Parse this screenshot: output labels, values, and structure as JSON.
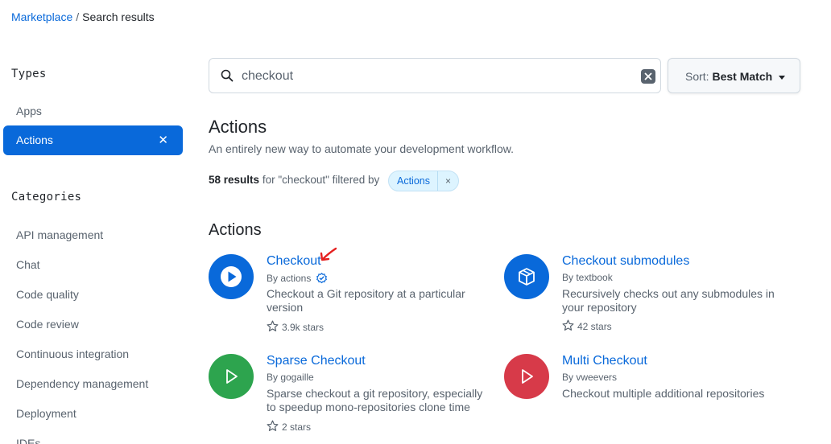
{
  "breadcrumb": {
    "root": "Marketplace",
    "separator": "/",
    "current": "Search results"
  },
  "sidebar": {
    "types_heading": "Types",
    "types": [
      {
        "label": "Apps"
      },
      {
        "label": "Actions",
        "remove": "✕"
      }
    ],
    "categories_heading": "Categories",
    "categories": [
      {
        "label": "API management"
      },
      {
        "label": "Chat"
      },
      {
        "label": "Code quality"
      },
      {
        "label": "Code review"
      },
      {
        "label": "Continuous integration"
      },
      {
        "label": "Dependency management"
      },
      {
        "label": "Deployment"
      },
      {
        "label": "IDEs"
      }
    ]
  },
  "search": {
    "value": "checkout",
    "clear_icon": "x-icon"
  },
  "sort": {
    "prefix": "Sort:",
    "value": "Best Match"
  },
  "header": {
    "title": "Actions",
    "subtitle": "An entirely new way to automate your development workflow."
  },
  "results": {
    "count": "58 results",
    "text": "for \"checkout\" filtered by",
    "chip": "Actions",
    "chip_remove": "×"
  },
  "list_title": "Actions",
  "cards": [
    {
      "name": "Checkout",
      "by": "By actions",
      "verified": true,
      "desc": "Checkout a Git repository at a particular version",
      "stars": "3.9k stars",
      "color": "#0969da",
      "icon": "play-icon"
    },
    {
      "name": "Checkout submodules",
      "by": "By textbook",
      "verified": false,
      "desc": "Recursively checks out any submodules in your repository",
      "stars": "42 stars",
      "color": "#0969da",
      "icon": "package-icon"
    },
    {
      "name": "Sparse Checkout",
      "by": "By gogaille",
      "verified": false,
      "desc": "Sparse checkout a git repository, especially to speedup mono-repositories clone time",
      "stars": "2 stars",
      "color": "#2da44e",
      "icon": "play-icon"
    },
    {
      "name": "Multi Checkout",
      "by": "By vweevers",
      "verified": false,
      "desc": "Checkout multiple additional repositories",
      "stars": "",
      "color": "#d73a49",
      "icon": "play-icon"
    }
  ],
  "annotation": {
    "arrow_color": "#e5201f"
  }
}
